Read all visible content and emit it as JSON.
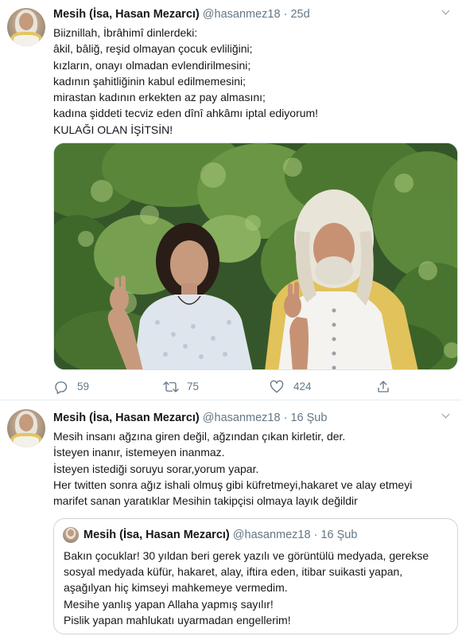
{
  "tweets": [
    {
      "name": "Mesih (İsa, Hasan Mezarcı)",
      "handle": "@hasanmez18",
      "separator": "·",
      "time": "25d",
      "lines": [
        "Biiznillah, İbrâhimî dinlerdeki:",
        "âkil, bâliğ, reşid olmayan çocuk evliliğini;",
        "kızların, onayı olmadan evlendirilmesini;",
        "kadının şahitliğinin kabul edilmemesini;",
        "mirastan kadının erkekten az pay almasını;",
        "kadına şiddeti tecviz eden dînî ahkâmı iptal ediyorum!",
        "KULAĞI OLAN İŞİTSİN!"
      ],
      "actions": {
        "replies": "59",
        "retweets": "75",
        "likes": "424"
      }
    },
    {
      "name": "Mesih (İsa, Hasan Mezarcı)",
      "handle": "@hasanmez18",
      "separator": "·",
      "time": "16 Şub",
      "lines": [
        "Mesih insanı ağzına giren değil, ağzından çıkan kirletir, der.",
        "İsteyen inanır, istemeyen inanmaz.",
        "İsteyen istediği soruyu sorar,yorum yapar.",
        "Her twitten sonra ağız ishali olmuş gibi küfretmeyi,hakaret ve alay etmeyi",
        "marifet sanan yaratıklar Mesihin takipçisi olmaya layık değildir"
      ],
      "quoted": {
        "name": "Mesih (İsa, Hasan Mezarcı)",
        "handle": "@hasanmez18",
        "separator": "·",
        "time": "16 Şub",
        "lines": [
          "Bakın çocuklar! 30 yıldan beri gerek yazılı ve görüntülü medyada, gerekse",
          "sosyal medyada küfür, hakaret, alay, iftira eden, itibar suikasti yapan,",
          "aşağılyan hiç kimseyi mahkemeye vermedim.",
          "Mesihe yanlış yapan Allaha yapmış sayılır!",
          "Pislik yapan mahlukatı uyarmadan engellerim!"
        ]
      }
    }
  ],
  "icons": {
    "reply": "reply-icon",
    "retweet": "retweet-icon",
    "like": "heart-icon",
    "share": "share-icon",
    "more": "chevron-down-icon"
  },
  "colors": {
    "text": "#14171a",
    "muted": "#657786",
    "border": "#e6ecf0"
  }
}
